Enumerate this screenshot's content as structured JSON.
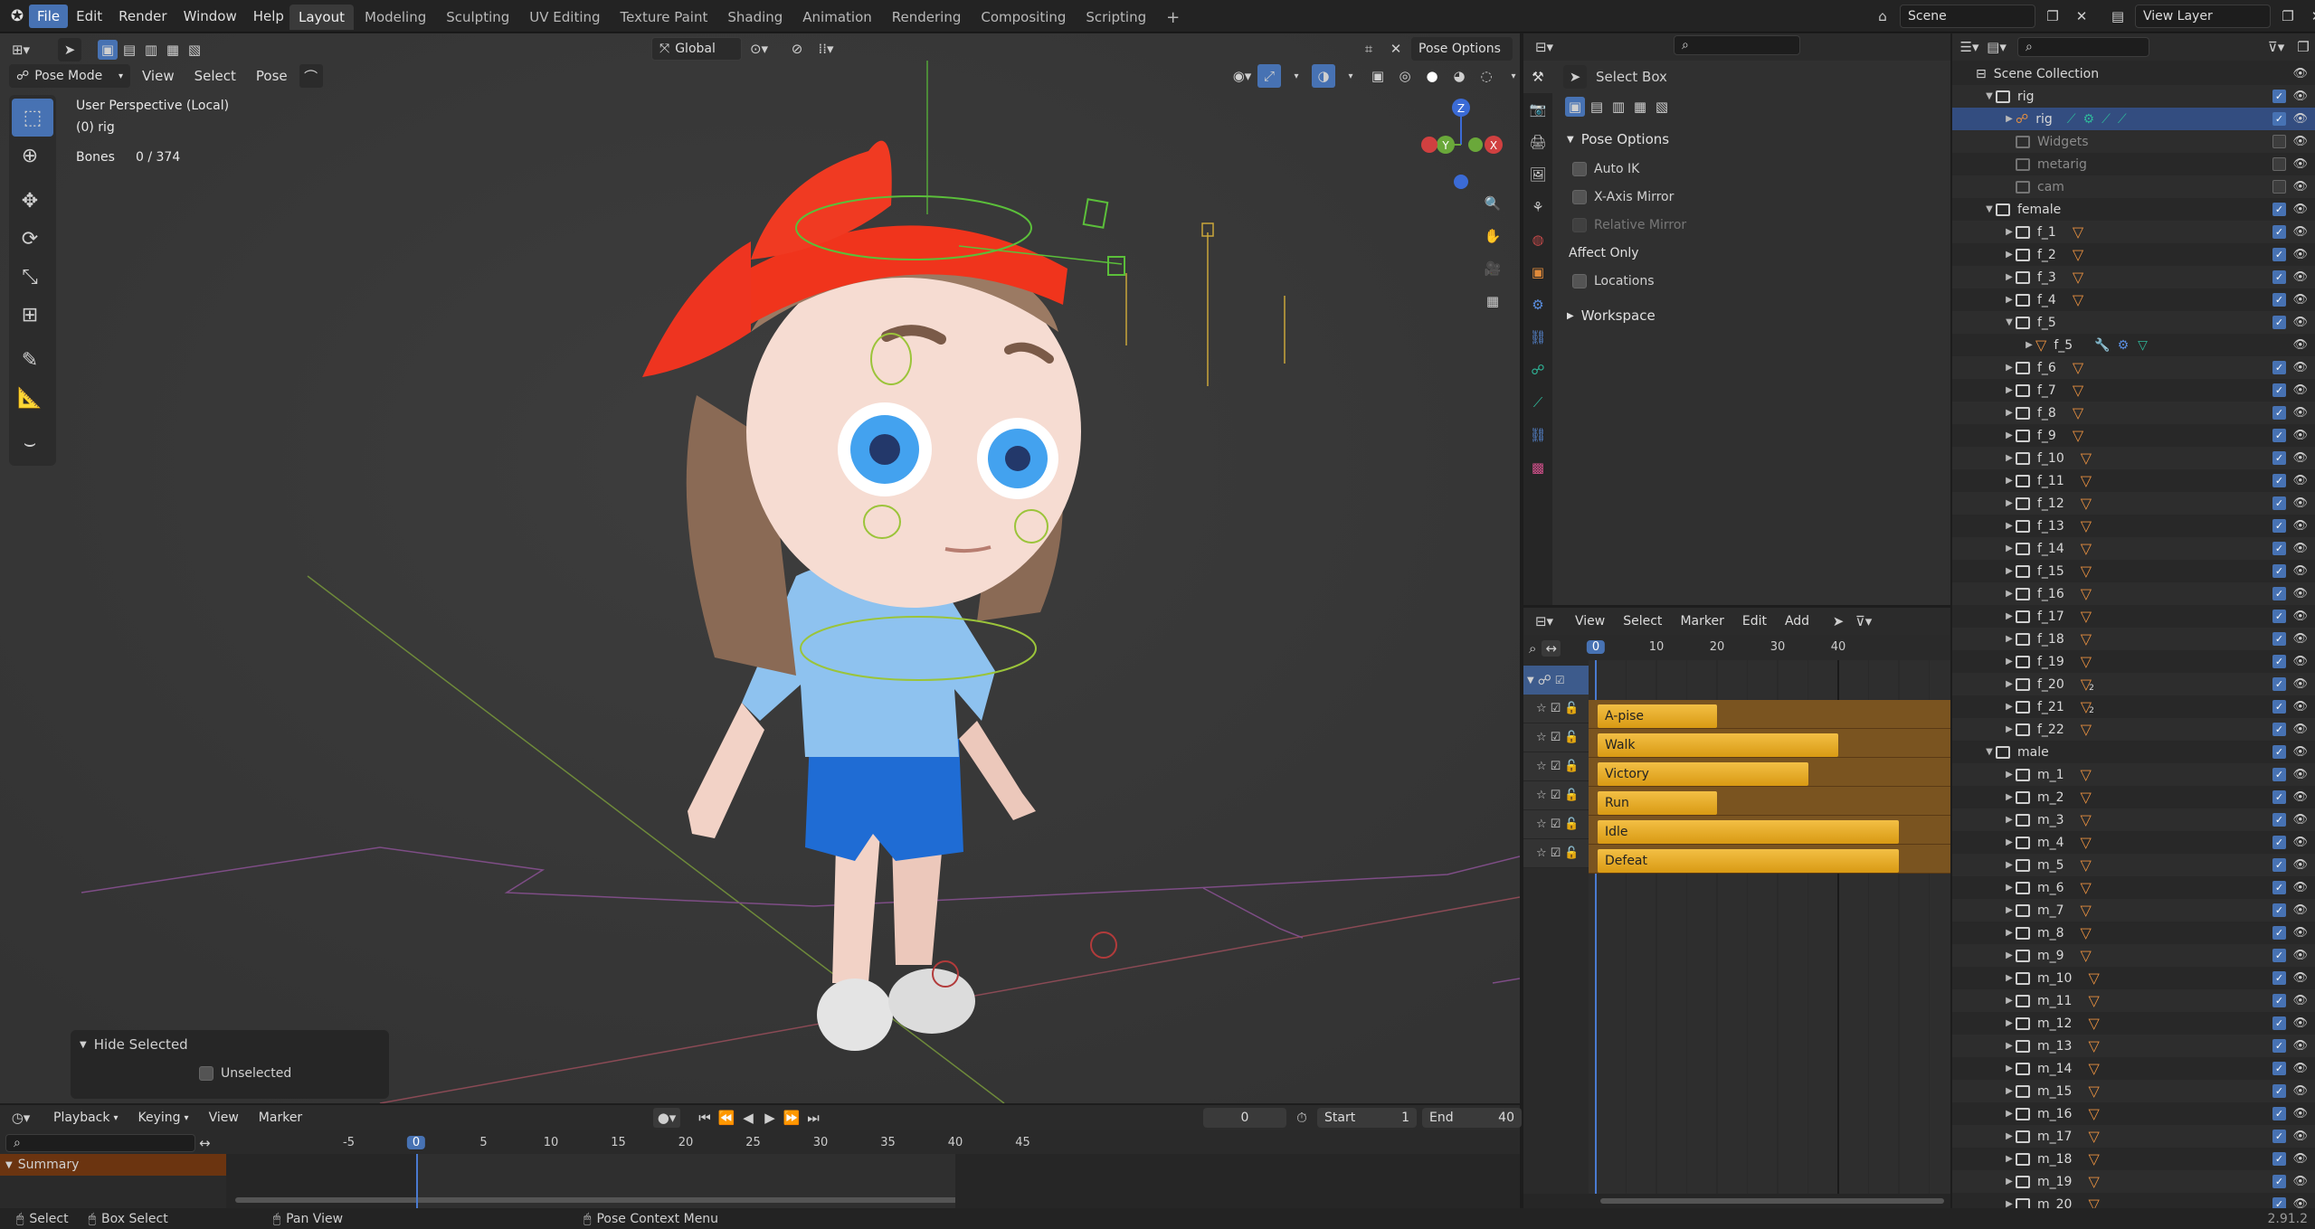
{
  "topbar": {
    "menus": [
      "File",
      "Edit",
      "Render",
      "Window",
      "Help"
    ],
    "workspaces": [
      "Layout",
      "Modeling",
      "Sculpting",
      "UV Editing",
      "Texture Paint",
      "Shading",
      "Animation",
      "Rendering",
      "Compositing",
      "Scripting"
    ],
    "add_tab": "+",
    "scene": "Scene",
    "view_layer": "View Layer"
  },
  "viewport": {
    "mode": "Pose Mode",
    "menus": [
      "View",
      "Select",
      "Pose"
    ],
    "orientation": "Global",
    "pose_options": "Pose Options",
    "overlay_line1": "User Perspective (Local)",
    "overlay_line2": "(0) rig",
    "bones_label": "Bones",
    "bones_value": "0 / 374",
    "gizmo": {
      "z": "Z",
      "x": "X",
      "y": "Y"
    },
    "redo_panel": {
      "title": "Hide Selected",
      "option": "Unselected"
    }
  },
  "properties": {
    "tool_name": "Select Box",
    "panel_pose_options": "Pose Options",
    "auto_ik": "Auto IK",
    "x_axis_mirror": "X-Axis Mirror",
    "relative_mirror": "Relative Mirror",
    "affect_only": "Affect Only",
    "locations": "Locations",
    "workspace": "Workspace"
  },
  "nla": {
    "menus": [
      "View",
      "Select",
      "Marker",
      "Edit",
      "Add"
    ],
    "ruler": [
      "0",
      "10",
      "20",
      "30",
      "40"
    ],
    "strips": [
      {
        "name": "A-pise",
        "start": 0,
        "end": 20
      },
      {
        "name": "Walk",
        "start": 0,
        "end": 40
      },
      {
        "name": "Victory",
        "start": 0,
        "end": 35
      },
      {
        "name": "Run",
        "start": 0,
        "end": 20
      },
      {
        "name": "Idle",
        "start": 0,
        "end": 50
      },
      {
        "name": "Defeat",
        "start": 0,
        "end": 50
      }
    ]
  },
  "outliner": {
    "rows": [
      {
        "label": "Scene Collection",
        "depth": 0,
        "kind": "scene",
        "check": "none"
      },
      {
        "label": "rig",
        "depth": 1,
        "kind": "coll",
        "check": "on",
        "open": true
      },
      {
        "label": "rig",
        "depth": 2,
        "kind": "armature",
        "check": "on",
        "sel": true
      },
      {
        "label": "Widgets",
        "depth": 2,
        "kind": "coll-dim",
        "check": "off"
      },
      {
        "label": "metarig",
        "depth": 2,
        "kind": "coll-dim",
        "check": "off"
      },
      {
        "label": "cam",
        "depth": 2,
        "kind": "coll-dim",
        "check": "off"
      },
      {
        "label": "female",
        "depth": 1,
        "kind": "coll",
        "check": "on",
        "open": true
      },
      {
        "label": "f_1",
        "depth": 2,
        "kind": "coll",
        "check": "on",
        "mesh": true
      },
      {
        "label": "f_2",
        "depth": 2,
        "kind": "coll",
        "check": "on",
        "mesh": true
      },
      {
        "label": "f_3",
        "depth": 2,
        "kind": "coll",
        "check": "on",
        "mesh": true
      },
      {
        "label": "f_4",
        "depth": 2,
        "kind": "coll",
        "check": "on",
        "mesh": true
      },
      {
        "label": "f_5",
        "depth": 2,
        "kind": "coll",
        "check": "on",
        "open": true
      },
      {
        "label": "f_5",
        "depth": 3,
        "kind": "mesh",
        "check": "none"
      },
      {
        "label": "f_6",
        "depth": 2,
        "kind": "coll",
        "check": "on",
        "mesh": true
      },
      {
        "label": "f_7",
        "depth": 2,
        "kind": "coll",
        "check": "on",
        "mesh": true
      },
      {
        "label": "f_8",
        "depth": 2,
        "kind": "coll",
        "check": "on",
        "mesh": true
      },
      {
        "label": "f_9",
        "depth": 2,
        "kind": "coll",
        "check": "on",
        "mesh": true
      },
      {
        "label": "f_10",
        "depth": 2,
        "kind": "coll",
        "check": "on",
        "mesh": true
      },
      {
        "label": "f_11",
        "depth": 2,
        "kind": "coll",
        "check": "on",
        "mesh": true
      },
      {
        "label": "f_12",
        "depth": 2,
        "kind": "coll",
        "check": "on",
        "mesh": true
      },
      {
        "label": "f_13",
        "depth": 2,
        "kind": "coll",
        "check": "on",
        "mesh": true
      },
      {
        "label": "f_14",
        "depth": 2,
        "kind": "coll",
        "check": "on",
        "mesh": true
      },
      {
        "label": "f_15",
        "depth": 2,
        "kind": "coll",
        "check": "on",
        "mesh": true
      },
      {
        "label": "f_16",
        "depth": 2,
        "kind": "coll",
        "check": "on",
        "mesh": true
      },
      {
        "label": "f_17",
        "depth": 2,
        "kind": "coll",
        "check": "on",
        "mesh": true
      },
      {
        "label": "f_18",
        "depth": 2,
        "kind": "coll",
        "check": "on",
        "mesh": true
      },
      {
        "label": "f_19",
        "depth": 2,
        "kind": "coll",
        "check": "on",
        "mesh": true
      },
      {
        "label": "f_20",
        "depth": 2,
        "kind": "coll",
        "check": "on",
        "mesh": true,
        "badge": "2"
      },
      {
        "label": "f_21",
        "depth": 2,
        "kind": "coll",
        "check": "on",
        "mesh": true,
        "badge": "2"
      },
      {
        "label": "f_22",
        "depth": 2,
        "kind": "coll",
        "check": "on",
        "mesh": true
      },
      {
        "label": "male",
        "depth": 1,
        "kind": "coll",
        "check": "on",
        "open": true
      },
      {
        "label": "m_1",
        "depth": 2,
        "kind": "coll",
        "check": "on",
        "mesh": true
      },
      {
        "label": "m_2",
        "depth": 2,
        "kind": "coll",
        "check": "on",
        "mesh": true
      },
      {
        "label": "m_3",
        "depth": 2,
        "kind": "coll",
        "check": "on",
        "mesh": true
      },
      {
        "label": "m_4",
        "depth": 2,
        "kind": "coll",
        "check": "on",
        "mesh": true
      },
      {
        "label": "m_5",
        "depth": 2,
        "kind": "coll",
        "check": "on",
        "mesh": true
      },
      {
        "label": "m_6",
        "depth": 2,
        "kind": "coll",
        "check": "on",
        "mesh": true
      },
      {
        "label": "m_7",
        "depth": 2,
        "kind": "coll",
        "check": "on",
        "mesh": true
      },
      {
        "label": "m_8",
        "depth": 2,
        "kind": "coll",
        "check": "on",
        "mesh": true
      },
      {
        "label": "m_9",
        "depth": 2,
        "kind": "coll",
        "check": "on",
        "mesh": true
      },
      {
        "label": "m_10",
        "depth": 2,
        "kind": "coll",
        "check": "on",
        "mesh": true
      },
      {
        "label": "m_11",
        "depth": 2,
        "kind": "coll",
        "check": "on",
        "mesh": true
      },
      {
        "label": "m_12",
        "depth": 2,
        "kind": "coll",
        "check": "on",
        "mesh": true
      },
      {
        "label": "m_13",
        "depth": 2,
        "kind": "coll",
        "check": "on",
        "mesh": true
      },
      {
        "label": "m_14",
        "depth": 2,
        "kind": "coll",
        "check": "on",
        "mesh": true
      },
      {
        "label": "m_15",
        "depth": 2,
        "kind": "coll",
        "check": "on",
        "mesh": true
      },
      {
        "label": "m_16",
        "depth": 2,
        "kind": "coll",
        "check": "on",
        "mesh": true
      },
      {
        "label": "m_17",
        "depth": 2,
        "kind": "coll",
        "check": "on",
        "mesh": true
      },
      {
        "label": "m_18",
        "depth": 2,
        "kind": "coll",
        "check": "on",
        "mesh": true
      },
      {
        "label": "m_19",
        "depth": 2,
        "kind": "coll",
        "check": "on",
        "mesh": true
      },
      {
        "label": "m_20",
        "depth": 2,
        "kind": "coll",
        "check": "on",
        "mesh": true
      }
    ]
  },
  "timeline": {
    "menus": [
      "Playback",
      "Keying",
      "View",
      "Marker"
    ],
    "current_frame": "0",
    "start_label": "Start",
    "start_value": "1",
    "end_label": "End",
    "end_value": "40",
    "ruler": [
      "-5",
      "0",
      "5",
      "10",
      "15",
      "20",
      "25",
      "30",
      "35",
      "40",
      "45"
    ],
    "summary": "Summary"
  },
  "statusbar": {
    "select": "Select",
    "box_select": "Box Select",
    "pan_view": "Pan View",
    "context_menu": "Pose Context Menu",
    "version": "2.91.2"
  },
  "colors": {
    "accent": "#4772b3",
    "strip": "#f0b93a",
    "header": "#232323"
  }
}
